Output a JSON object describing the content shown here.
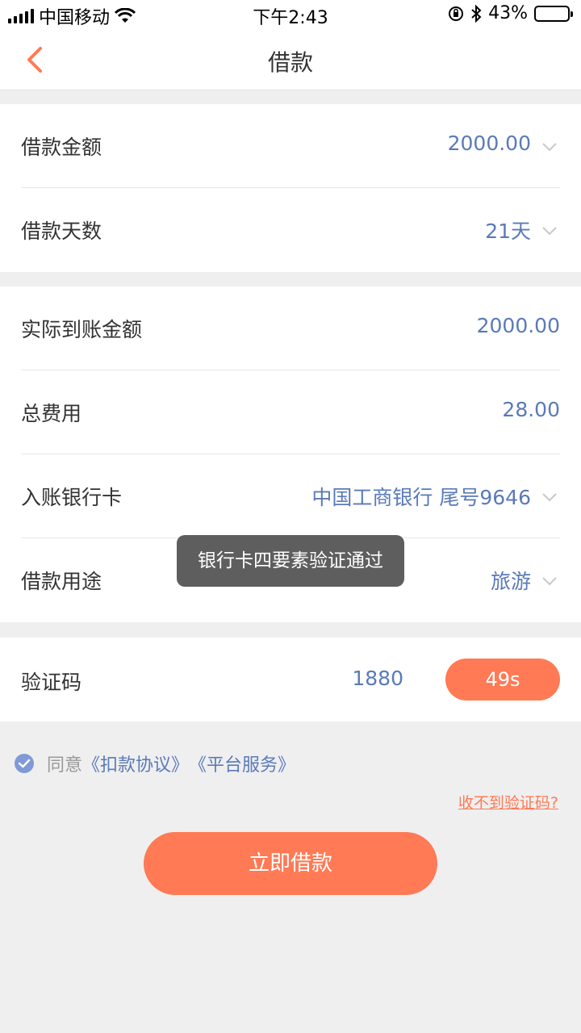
{
  "status_bar": {
    "carrier": "中国移动",
    "time": "下午2:43",
    "battery_percent": "43%",
    "battery_level": 0.43,
    "icons": [
      "signal-icon",
      "wifi-icon",
      "orientation-lock-icon",
      "bluetooth-icon",
      "battery-icon"
    ]
  },
  "nav": {
    "title": "借款",
    "back_icon": "chevron-left-icon"
  },
  "loan_section": [
    {
      "label": "借款金额",
      "value": "2000.00",
      "has_chevron": true
    },
    {
      "label": "借款天数",
      "value": "21天",
      "has_chevron": true
    }
  ],
  "detail_section": [
    {
      "label": "实际到账金额",
      "value": "2000.00",
      "has_chevron": false
    },
    {
      "label": "总费用",
      "value": "28.00",
      "has_chevron": false
    },
    {
      "label": "入账银行卡",
      "value": "中国工商银行 尾号9646",
      "has_chevron": true
    },
    {
      "label": "借款用途",
      "value": "旅游",
      "has_chevron": true
    }
  ],
  "verification": {
    "label": "验证码",
    "code": "1880",
    "countdown": "49s"
  },
  "agreement": {
    "checked": true,
    "prefix": "同意",
    "link1": "《扣款协议》",
    "link2": "《平台服务》"
  },
  "no_code_link": "收不到验证码?",
  "submit_label": "立即借款",
  "toast": "银行卡四要素验证通过",
  "colors": {
    "accent": "#ff7a55",
    "value_blue": "#5a7ab8",
    "background": "#efefef"
  }
}
